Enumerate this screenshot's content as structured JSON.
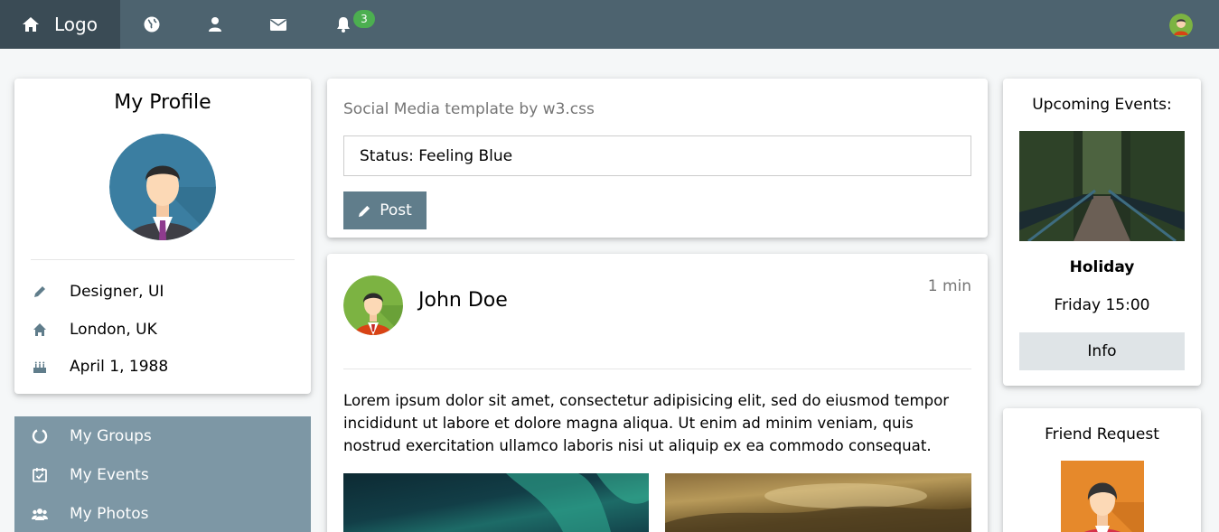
{
  "topbar": {
    "logo_label": "Logo",
    "notification_count": "3",
    "icons": [
      "home-icon",
      "globe-icon",
      "user-icon",
      "envelope-icon",
      "bell-icon"
    ]
  },
  "profile": {
    "title": "My Profile",
    "info": [
      {
        "icon": "pencil-icon",
        "text": "Designer, UI"
      },
      {
        "icon": "home-icon",
        "text": "London, UK"
      },
      {
        "icon": "birthday-cake-icon",
        "text": "April 1, 1988"
      }
    ]
  },
  "menu": {
    "items": [
      {
        "icon": "circle-notch-icon",
        "label": "My Groups"
      },
      {
        "icon": "calendar-check-icon",
        "label": "My Events"
      },
      {
        "icon": "users-icon",
        "label": "My Photos"
      }
    ]
  },
  "status": {
    "title": "Social Media template by w3.css",
    "input_value": "Status: Feeling Blue",
    "post_label": "Post"
  },
  "post": {
    "author": "John Doe",
    "time": "1 min",
    "body": "Lorem ipsum dolor sit amet, consectetur adipisicing elit, sed do eiusmod tempor incididunt ut labore et dolore magna aliqua. Ut enim ad minim veniam, quis nostrud exercitation ullamco laboris nisi ut aliquip ex ea commodo consequat."
  },
  "events": {
    "title": "Upcoming Events:",
    "name": "Holiday",
    "when": "Friday 15:00",
    "info_label": "Info"
  },
  "friend": {
    "title": "Friend Request"
  },
  "colors": {
    "topbar": "#4d636f",
    "topbar_logo": "#3a4b55",
    "accordion": "#7d97a5",
    "post_button": "#607d8b",
    "badge": "#4caf50",
    "info_button": "#dfe4e7"
  }
}
